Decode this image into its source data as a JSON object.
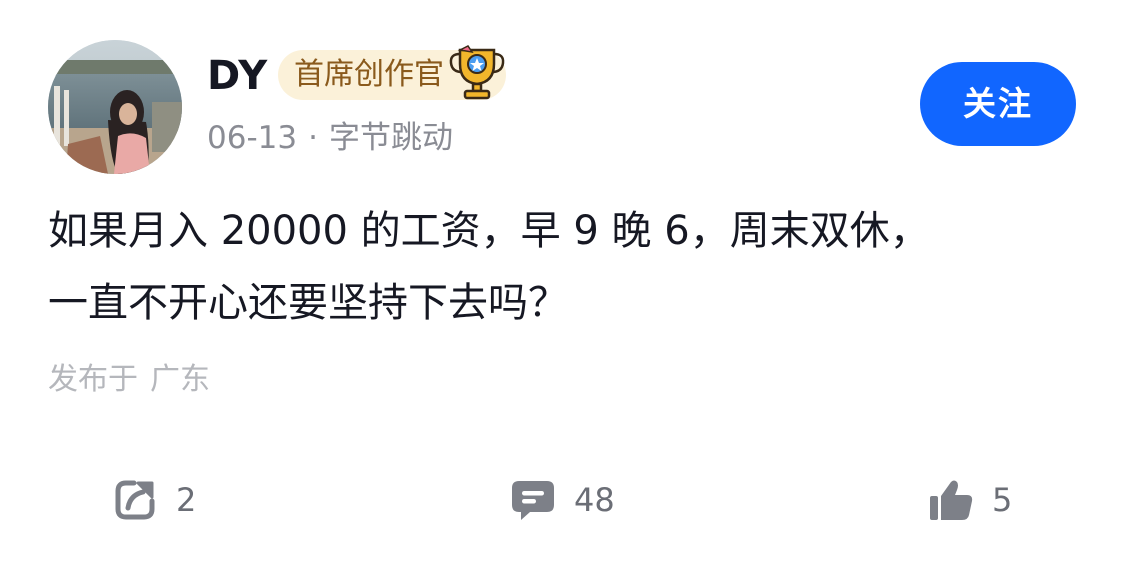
{
  "author": {
    "name": "DY",
    "badge": "首席创作官",
    "date": "06-13",
    "separator": "·",
    "company": "字节跳动"
  },
  "follow_button": {
    "label": "关注"
  },
  "post": {
    "line1": "如果月入 20000 的工资，早 9 晚 6，周末双休，",
    "line2": "一直不开心还要坚持下去吗？",
    "location_prefix": "发布于",
    "location": "广东"
  },
  "actions": {
    "share_count": "2",
    "comment_count": "48",
    "like_count": "5"
  },
  "icons": {
    "share": "share-arrow-icon",
    "comment": "comment-bubble-icon",
    "like": "thumbs-up-icon",
    "badge": "trophy-icon"
  },
  "colors": {
    "accent": "#1166ff",
    "badge_bg": "#fbf1d9",
    "badge_text": "#8a5a1c",
    "text_primary": "#161823",
    "text_secondary": "#8a8c94",
    "text_tertiary": "#b5b7bc"
  }
}
